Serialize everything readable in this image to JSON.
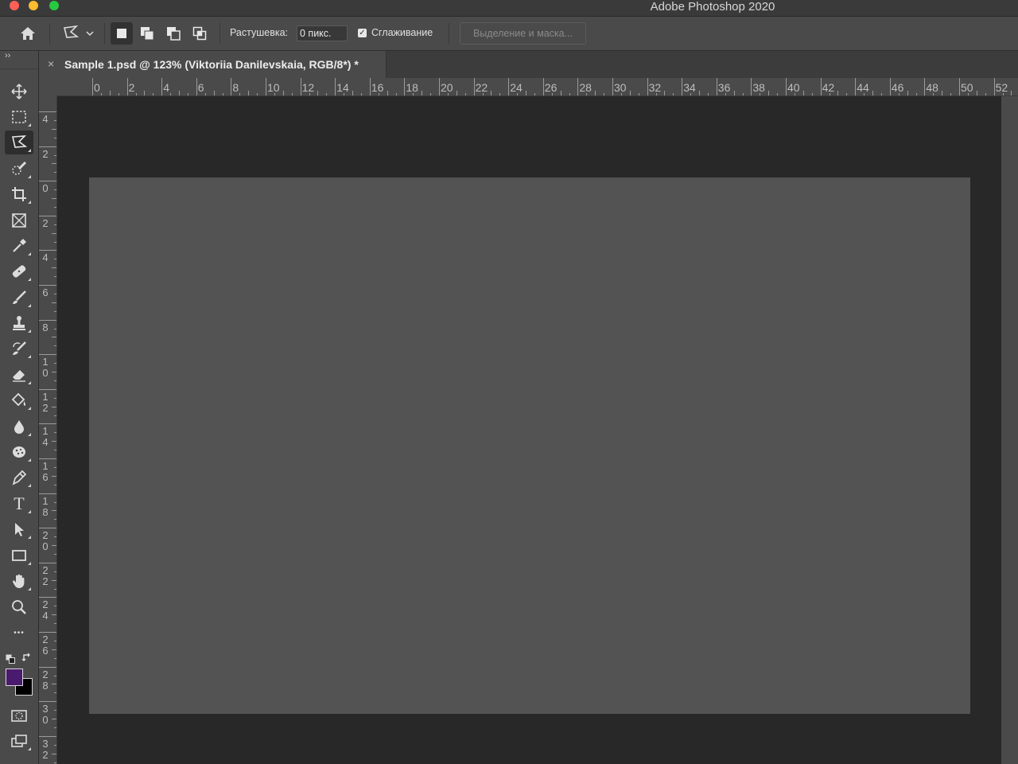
{
  "window": {
    "title": "Adobe Photoshop 2020"
  },
  "options_bar": {
    "feather_label": "Растушевка:",
    "feather_value": "0 пикс.",
    "antialias_label": "Сглаживание",
    "antialias_checked": true,
    "select_mask_label": "Выделение и маска..."
  },
  "document_tab": {
    "close_glyph": "×",
    "title": "Sample 1.psd @ 123% (Viktoriia Danilevskaia, RGB/8*) *"
  },
  "toolbar": {
    "collapse_glyph": "››",
    "tools": [
      {
        "name": "move-tool",
        "icon": "move-icon"
      },
      {
        "name": "rectangular-marquee-tool",
        "icon": "marquee-icon"
      },
      {
        "name": "lasso-tool",
        "icon": "polygonal-lasso-icon",
        "active": true
      },
      {
        "name": "quick-selection-tool",
        "icon": "quick-selection-icon"
      },
      {
        "name": "crop-tool",
        "icon": "crop-icon"
      },
      {
        "name": "frame-tool",
        "icon": "frame-icon"
      },
      {
        "name": "eyedropper-tool",
        "icon": "eyedropper-icon"
      },
      {
        "name": "healing-brush-tool",
        "icon": "bandage-icon"
      },
      {
        "name": "brush-tool",
        "icon": "brush-icon"
      },
      {
        "name": "clone-stamp-tool",
        "icon": "stamp-icon"
      },
      {
        "name": "history-brush-tool",
        "icon": "history-brush-icon"
      },
      {
        "name": "eraser-tool",
        "icon": "eraser-icon"
      },
      {
        "name": "paint-bucket-tool",
        "icon": "paint-bucket-icon"
      },
      {
        "name": "blur-tool",
        "icon": "drop-icon"
      },
      {
        "name": "sponge-tool",
        "icon": "sponge-icon"
      },
      {
        "name": "pen-tool",
        "icon": "pen-icon"
      },
      {
        "name": "type-tool",
        "icon": "type-icon",
        "glyph": "T"
      },
      {
        "name": "path-selection-tool",
        "icon": "arrow-icon"
      },
      {
        "name": "rectangle-tool",
        "icon": "rectangle-icon"
      },
      {
        "name": "hand-tool",
        "icon": "hand-icon"
      },
      {
        "name": "zoom-tool",
        "icon": "magnifier-icon"
      },
      {
        "name": "more-tools",
        "icon": "ellipsis-icon",
        "glyph": "•••"
      }
    ],
    "foreground_color": "#4a1a6e",
    "background_color": "#000000"
  },
  "rulers": {
    "top_labels": [
      "0",
      "2",
      "4",
      "6",
      "8",
      "10",
      "12",
      "14",
      "16",
      "18",
      "20",
      "22",
      "24",
      "26",
      "28",
      "30",
      "32",
      "34",
      "36",
      "38",
      "40",
      "42",
      "44",
      "46",
      "48",
      "50",
      "52"
    ],
    "left_labels": [
      [
        "4"
      ],
      [
        "2"
      ],
      [
        "0"
      ],
      [
        "2"
      ],
      [
        "4"
      ],
      [
        "6"
      ],
      [
        "8"
      ],
      [
        "1",
        "0"
      ],
      [
        "1",
        "2"
      ],
      [
        "1",
        "4"
      ],
      [
        "1",
        "6"
      ],
      [
        "1",
        "8"
      ],
      [
        "2",
        "0"
      ],
      [
        "2",
        "2"
      ],
      [
        "2",
        "4"
      ],
      [
        "2",
        "6"
      ],
      [
        "2",
        "8"
      ],
      [
        "3",
        "0"
      ],
      [
        "3",
        "2"
      ]
    ]
  },
  "colors": {
    "ui_panel": "#4a4a4a",
    "pasteboard": "#282828",
    "canvas": "#535353"
  }
}
